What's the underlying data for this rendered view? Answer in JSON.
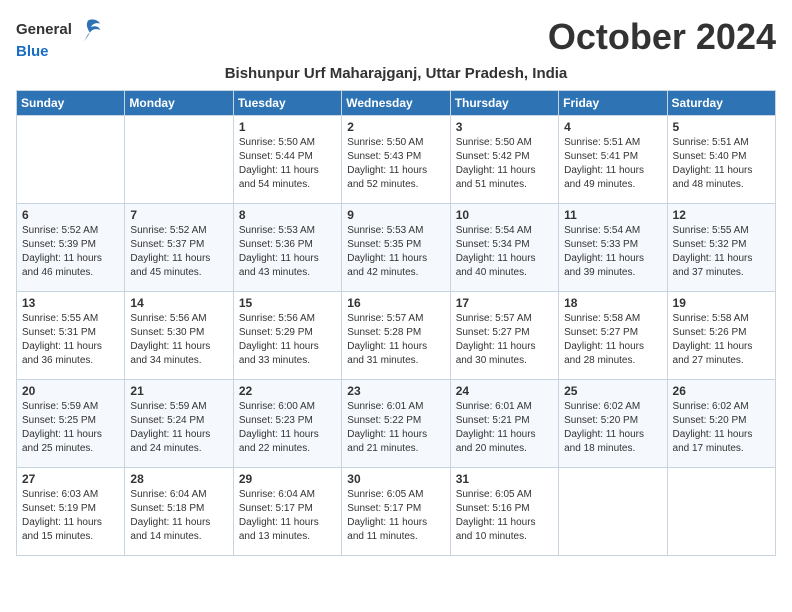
{
  "header": {
    "logo_general": "General",
    "logo_blue": "Blue",
    "month_title": "October 2024",
    "location": "Bishunpur Urf Maharajganj, Uttar Pradesh, India"
  },
  "weekdays": [
    "Sunday",
    "Monday",
    "Tuesday",
    "Wednesday",
    "Thursday",
    "Friday",
    "Saturday"
  ],
  "weeks": [
    [
      {
        "day": "",
        "info": ""
      },
      {
        "day": "",
        "info": ""
      },
      {
        "day": "1",
        "info": "Sunrise: 5:50 AM\nSunset: 5:44 PM\nDaylight: 11 hours and 54 minutes."
      },
      {
        "day": "2",
        "info": "Sunrise: 5:50 AM\nSunset: 5:43 PM\nDaylight: 11 hours and 52 minutes."
      },
      {
        "day": "3",
        "info": "Sunrise: 5:50 AM\nSunset: 5:42 PM\nDaylight: 11 hours and 51 minutes."
      },
      {
        "day": "4",
        "info": "Sunrise: 5:51 AM\nSunset: 5:41 PM\nDaylight: 11 hours and 49 minutes."
      },
      {
        "day": "5",
        "info": "Sunrise: 5:51 AM\nSunset: 5:40 PM\nDaylight: 11 hours and 48 minutes."
      }
    ],
    [
      {
        "day": "6",
        "info": "Sunrise: 5:52 AM\nSunset: 5:39 PM\nDaylight: 11 hours and 46 minutes."
      },
      {
        "day": "7",
        "info": "Sunrise: 5:52 AM\nSunset: 5:37 PM\nDaylight: 11 hours and 45 minutes."
      },
      {
        "day": "8",
        "info": "Sunrise: 5:53 AM\nSunset: 5:36 PM\nDaylight: 11 hours and 43 minutes."
      },
      {
        "day": "9",
        "info": "Sunrise: 5:53 AM\nSunset: 5:35 PM\nDaylight: 11 hours and 42 minutes."
      },
      {
        "day": "10",
        "info": "Sunrise: 5:54 AM\nSunset: 5:34 PM\nDaylight: 11 hours and 40 minutes."
      },
      {
        "day": "11",
        "info": "Sunrise: 5:54 AM\nSunset: 5:33 PM\nDaylight: 11 hours and 39 minutes."
      },
      {
        "day": "12",
        "info": "Sunrise: 5:55 AM\nSunset: 5:32 PM\nDaylight: 11 hours and 37 minutes."
      }
    ],
    [
      {
        "day": "13",
        "info": "Sunrise: 5:55 AM\nSunset: 5:31 PM\nDaylight: 11 hours and 36 minutes."
      },
      {
        "day": "14",
        "info": "Sunrise: 5:56 AM\nSunset: 5:30 PM\nDaylight: 11 hours and 34 minutes."
      },
      {
        "day": "15",
        "info": "Sunrise: 5:56 AM\nSunset: 5:29 PM\nDaylight: 11 hours and 33 minutes."
      },
      {
        "day": "16",
        "info": "Sunrise: 5:57 AM\nSunset: 5:28 PM\nDaylight: 11 hours and 31 minutes."
      },
      {
        "day": "17",
        "info": "Sunrise: 5:57 AM\nSunset: 5:27 PM\nDaylight: 11 hours and 30 minutes."
      },
      {
        "day": "18",
        "info": "Sunrise: 5:58 AM\nSunset: 5:27 PM\nDaylight: 11 hours and 28 minutes."
      },
      {
        "day": "19",
        "info": "Sunrise: 5:58 AM\nSunset: 5:26 PM\nDaylight: 11 hours and 27 minutes."
      }
    ],
    [
      {
        "day": "20",
        "info": "Sunrise: 5:59 AM\nSunset: 5:25 PM\nDaylight: 11 hours and 25 minutes."
      },
      {
        "day": "21",
        "info": "Sunrise: 5:59 AM\nSunset: 5:24 PM\nDaylight: 11 hours and 24 minutes."
      },
      {
        "day": "22",
        "info": "Sunrise: 6:00 AM\nSunset: 5:23 PM\nDaylight: 11 hours and 22 minutes."
      },
      {
        "day": "23",
        "info": "Sunrise: 6:01 AM\nSunset: 5:22 PM\nDaylight: 11 hours and 21 minutes."
      },
      {
        "day": "24",
        "info": "Sunrise: 6:01 AM\nSunset: 5:21 PM\nDaylight: 11 hours and 20 minutes."
      },
      {
        "day": "25",
        "info": "Sunrise: 6:02 AM\nSunset: 5:20 PM\nDaylight: 11 hours and 18 minutes."
      },
      {
        "day": "26",
        "info": "Sunrise: 6:02 AM\nSunset: 5:20 PM\nDaylight: 11 hours and 17 minutes."
      }
    ],
    [
      {
        "day": "27",
        "info": "Sunrise: 6:03 AM\nSunset: 5:19 PM\nDaylight: 11 hours and 15 minutes."
      },
      {
        "day": "28",
        "info": "Sunrise: 6:04 AM\nSunset: 5:18 PM\nDaylight: 11 hours and 14 minutes."
      },
      {
        "day": "29",
        "info": "Sunrise: 6:04 AM\nSunset: 5:17 PM\nDaylight: 11 hours and 13 minutes."
      },
      {
        "day": "30",
        "info": "Sunrise: 6:05 AM\nSunset: 5:17 PM\nDaylight: 11 hours and 11 minutes."
      },
      {
        "day": "31",
        "info": "Sunrise: 6:05 AM\nSunset: 5:16 PM\nDaylight: 11 hours and 10 minutes."
      },
      {
        "day": "",
        "info": ""
      },
      {
        "day": "",
        "info": ""
      }
    ]
  ]
}
